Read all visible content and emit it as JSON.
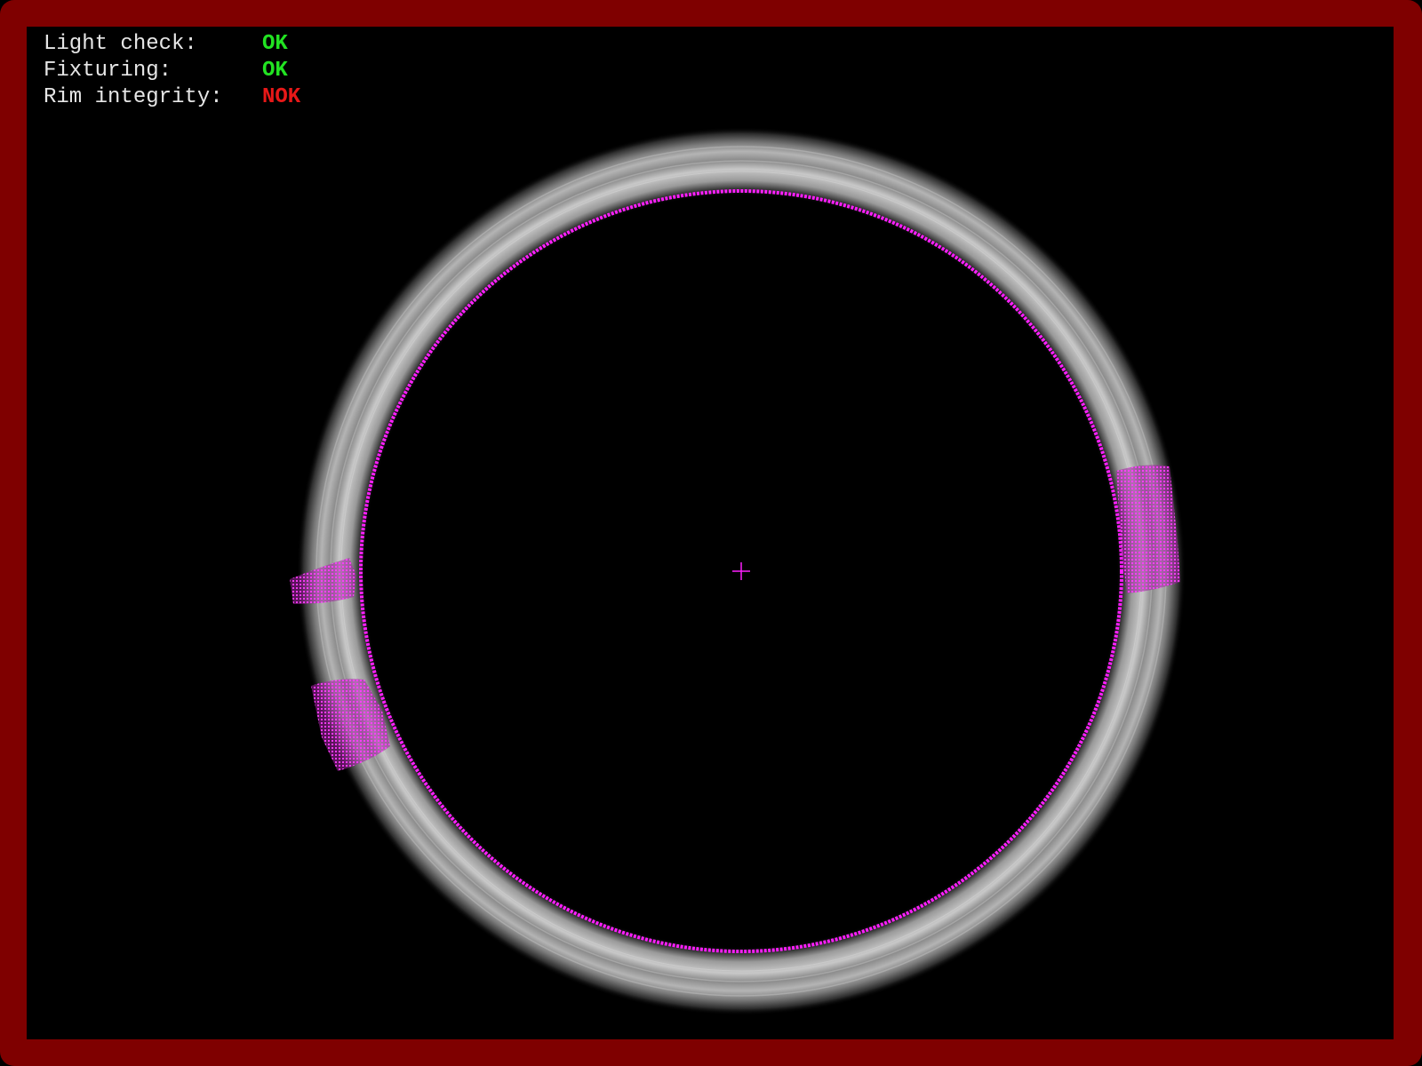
{
  "status": {
    "rows": [
      {
        "label": "Light check:",
        "value": "OK",
        "state": "ok"
      },
      {
        "label": "Fixturing:",
        "value": "OK",
        "state": "ok"
      },
      {
        "label": "Rim integrity:",
        "value": "NOK",
        "state": "nok"
      }
    ]
  },
  "colors": {
    "frame": "#7f0000",
    "background": "#000000",
    "label_text": "#e6e6e6",
    "ok": "#22e322",
    "nok": "#e81818",
    "overlay": "#ff1fff",
    "rim": "#9a9a9a"
  },
  "overlay": {
    "reference_circle": "magenta-fit-circle",
    "center_marker": "crosshair-icon",
    "defect_count": 3
  }
}
